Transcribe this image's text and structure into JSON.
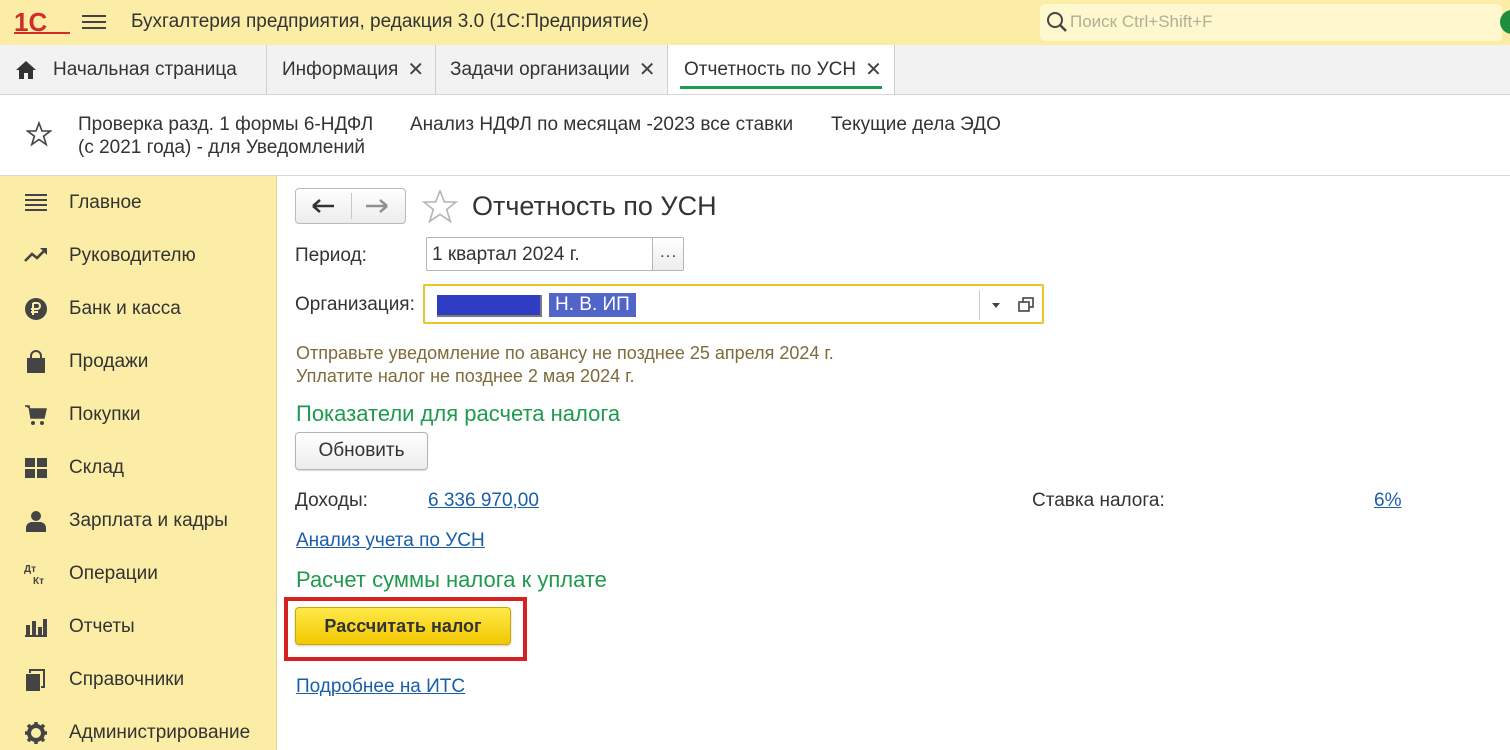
{
  "app": {
    "title": "Бухгалтерия предприятия, редакция 3.0  (1С:Предприятие)",
    "logo_text": "1С",
    "search_placeholder": "Поиск Ctrl+Shift+F"
  },
  "tabs": [
    {
      "label": "Начальная страница",
      "closable": false,
      "active": false
    },
    {
      "label": "Информация",
      "closable": true,
      "active": false
    },
    {
      "label": "Задачи организации",
      "closable": true,
      "active": false
    },
    {
      "label": "Отчетность по УСН",
      "closable": true,
      "active": true
    }
  ],
  "favorites": [
    {
      "line1": "Проверка разд. 1 формы 6-НДФЛ",
      "line2": "(с 2021 года) - для Уведомлений"
    },
    {
      "line1": "Анализ НДФЛ по месяцам -2023 все ставки",
      "line2": ""
    },
    {
      "line1": "Текущие дела ЭДО",
      "line2": ""
    }
  ],
  "sidebar": {
    "items": [
      {
        "label": "Главное",
        "icon": "menu-lines-icon"
      },
      {
        "label": "Руководителю",
        "icon": "trend-icon"
      },
      {
        "label": "Банк и касса",
        "icon": "ruble-coin-icon"
      },
      {
        "label": "Продажи",
        "icon": "shopping-bag-icon"
      },
      {
        "label": "Покупки",
        "icon": "cart-icon"
      },
      {
        "label": "Склад",
        "icon": "warehouse-grid-icon"
      },
      {
        "label": "Зарплата и кадры",
        "icon": "person-icon"
      },
      {
        "label": "Операции",
        "icon": "debit-credit-icon"
      },
      {
        "label": "Отчеты",
        "icon": "bar-chart-icon"
      },
      {
        "label": "Справочники",
        "icon": "books-icon"
      },
      {
        "label": "Администрирование",
        "icon": "gear-icon"
      }
    ],
    "dt_label": "Дт",
    "kt_label": "Кт"
  },
  "form": {
    "title": "Отчетность по УСН",
    "period_label": "Период:",
    "period_value": "1 квартал 2024 г.",
    "period_button": "...",
    "org_label": "Организация:",
    "org_value": "Н. В. ИП",
    "note1": "Отправьте уведомление по авансу не позднее 25 апреля 2024 г.",
    "note2": "Уплатите налог не позднее 2 мая 2024 г.",
    "section_indicators": "Показатели для расчета налога",
    "refresh_button": "Обновить",
    "income_label": "Доходы:",
    "income_value": "6 336 970,00",
    "rate_label": "Ставка налога:",
    "rate_value": "6%",
    "analysis_link": "Анализ учета по УСН",
    "section_calc": "Расчет суммы налога к уплате",
    "calc_button": "Рассчитать налог",
    "its_link": "Подробнее на ИТС"
  },
  "colors": {
    "panel_yellow": "#fbeda6",
    "accent_green": "#1e9a4d",
    "link_blue": "#1a5ea8",
    "highlight_red": "#d62121",
    "primary_button": "#f2c800"
  }
}
